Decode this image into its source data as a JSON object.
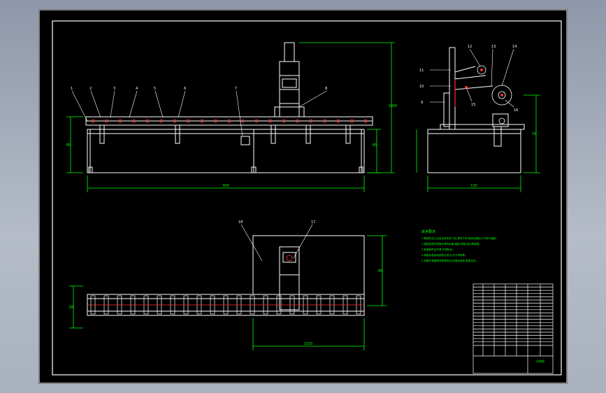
{
  "drawing": {
    "kind": "cad-assembly-drawing",
    "background": "#000000",
    "line_color": "#ffffff",
    "dimension_color": "#00ff00",
    "highlight_color": "#ff3030",
    "front_view": {
      "leaders": [
        "1",
        "2",
        "3",
        "4",
        "5",
        "6",
        "7",
        "8"
      ],
      "dim_width": "300",
      "dim_height_left": "85",
      "dim_height_right": "85",
      "dim_top": "1000"
    },
    "side_view": {
      "leaders": [
        "11",
        "10",
        "9",
        "12",
        "13",
        "14",
        "15",
        "16"
      ],
      "dim_width": "130",
      "dim_height": "70"
    },
    "top_view": {
      "leaders": [
        "18",
        "17"
      ],
      "dim_width": "1320",
      "dim_height_left": "56",
      "dim_height_right": "85"
    },
    "tech_notes": {
      "title": "技术要求",
      "lines": [
        "1.零部件加工后应去除毛刺飞边,清洗干净,检查合格后方可进行装配。",
        "2.装配前零件表面不得有划痕,磕碰,锈蚀,油污等缺陷。",
        "3.各紧固件应拧紧,不得松动。",
        "4.装配后各运动部件应灵活,无卡滞现象。",
        "5.设备外表面喷涂防锈漆后,再喷涂面漆,颜色自定。"
      ]
    },
    "title_block": {
      "drawing_name": "总装图"
    }
  }
}
